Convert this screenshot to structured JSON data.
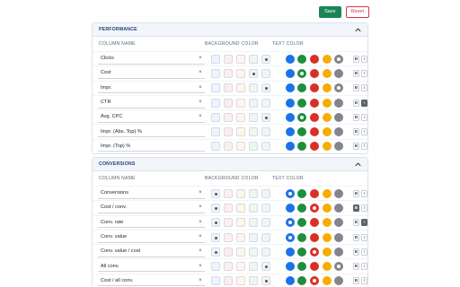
{
  "toolbar": {
    "save_label": "Save",
    "reset_label": "Reset"
  },
  "colors": {
    "bg_swatches": [
      "#eef4fd",
      "#fdeeee",
      "#fdf7e8",
      "#edf7ef",
      "#f1f3f5"
    ],
    "text_colors": [
      "#1a73e8",
      "#1e8e3e",
      "#d93025",
      "#f9ab00",
      "#80868b"
    ]
  },
  "sections": [
    {
      "title": "PERFORMANCE",
      "col_name": "COLUMN NAME",
      "col_bg": "BACKGROUND COLOR",
      "col_text": "TEXT COLOR",
      "rows": [
        {
          "name": "Clicks",
          "clear": "×",
          "bg_selected": 4,
          "text_selected": 4,
          "bold": "B",
          "italic": "I",
          "bold_on": false,
          "italic_on": false
        },
        {
          "name": "Cost",
          "clear": "×",
          "bg_selected": 3,
          "text_selected": 1,
          "bold": "B",
          "italic": "I",
          "bold_on": false,
          "italic_on": false
        },
        {
          "name": "Impr.",
          "clear": "×",
          "bg_selected": 4,
          "text_selected": 4,
          "bold": "B",
          "italic": "I",
          "bold_on": false,
          "italic_on": false
        },
        {
          "name": "CTR",
          "clear": "×",
          "bg_selected": -1,
          "text_selected": -1,
          "bold": "B",
          "italic": "I",
          "bold_on": false,
          "italic_on": true
        },
        {
          "name": "Avg. CPC",
          "clear": "×",
          "bg_selected": 4,
          "text_selected": 1,
          "bold": "B",
          "italic": "I",
          "bold_on": false,
          "italic_on": false
        },
        {
          "name": "Impr. (Abs. Top) %",
          "clear": "",
          "bg_selected": -1,
          "text_selected": -1,
          "bold": "B",
          "italic": "I",
          "bold_on": false,
          "italic_on": false
        },
        {
          "name": "Impr. (Top) %",
          "clear": "",
          "bg_selected": -1,
          "text_selected": -1,
          "bold": "B",
          "italic": "I",
          "bold_on": false,
          "italic_on": false
        }
      ]
    },
    {
      "title": "CONVERSIONS",
      "col_name": "COLUMN NAME",
      "col_bg": "BACKGROUND COLOR",
      "col_text": "TEXT COLOR",
      "rows": [
        {
          "name": "Conversions",
          "clear": "×",
          "bg_selected": 0,
          "text_selected": 0,
          "bold": "B",
          "italic": "I",
          "bold_on": false,
          "italic_on": false
        },
        {
          "name": "Cost / conv.",
          "clear": "×",
          "bg_selected": 0,
          "text_selected": 2,
          "bold": "B",
          "italic": "I",
          "bold_on": true,
          "italic_on": false
        },
        {
          "name": "Conv. rate",
          "clear": "×",
          "bg_selected": 0,
          "text_selected": 0,
          "bold": "B",
          "italic": "I",
          "bold_on": false,
          "italic_on": true
        },
        {
          "name": "Conv. value",
          "clear": "×",
          "bg_selected": 0,
          "text_selected": 0,
          "bold": "B",
          "italic": "I",
          "bold_on": false,
          "italic_on": false
        },
        {
          "name": "Conv. value / cost",
          "clear": "×",
          "bg_selected": 0,
          "text_selected": 2,
          "bold": "B",
          "italic": "I",
          "bold_on": false,
          "italic_on": false
        },
        {
          "name": "All conv.",
          "clear": "×",
          "bg_selected": 4,
          "text_selected": 4,
          "bold": "B",
          "italic": "I",
          "bold_on": false,
          "italic_on": false
        },
        {
          "name": "Cost / all conv.",
          "clear": "×",
          "bg_selected": 4,
          "text_selected": 2,
          "bold": "B",
          "italic": "I",
          "bold_on": false,
          "italic_on": false
        }
      ]
    }
  ]
}
